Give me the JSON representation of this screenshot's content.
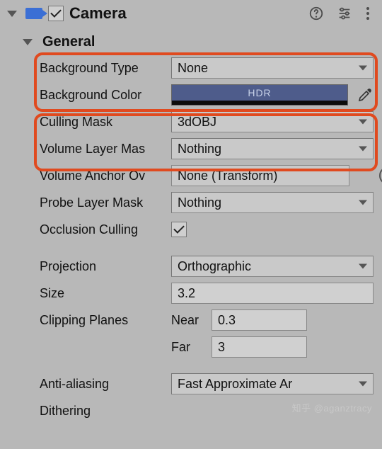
{
  "component": {
    "name": "Camera",
    "enabled": true
  },
  "section": {
    "title": "General"
  },
  "fields": {
    "backgroundType": {
      "label": "Background Type",
      "value": "None"
    },
    "backgroundColor": {
      "label": "Background Color",
      "badge": "HDR",
      "hex": "#4e5c8b"
    },
    "cullingMask": {
      "label": "Culling Mask",
      "value": "3dOBJ"
    },
    "volumeLayerMask": {
      "label": "Volume Layer Mas",
      "value": "Nothing"
    },
    "volumeAnchorOverride": {
      "label": "Volume Anchor Ov",
      "value": "None (Transform)"
    },
    "probeLayerMask": {
      "label": "Probe Layer Mask",
      "value": "Nothing"
    },
    "occlusionCulling": {
      "label": "Occlusion Culling",
      "value": true
    },
    "projection": {
      "label": "Projection",
      "value": "Orthographic"
    },
    "size": {
      "label": "Size",
      "value": "3.2"
    },
    "clippingPlanes": {
      "label": "Clipping Planes",
      "nearLabel": "Near",
      "near": "0.3",
      "farLabel": "Far",
      "far": "3"
    },
    "antiAliasing": {
      "label": "Anti-aliasing",
      "value": "Fast Approximate Ar"
    },
    "dithering": {
      "label": "Dithering"
    }
  },
  "watermark": "知乎 @aganztracy"
}
